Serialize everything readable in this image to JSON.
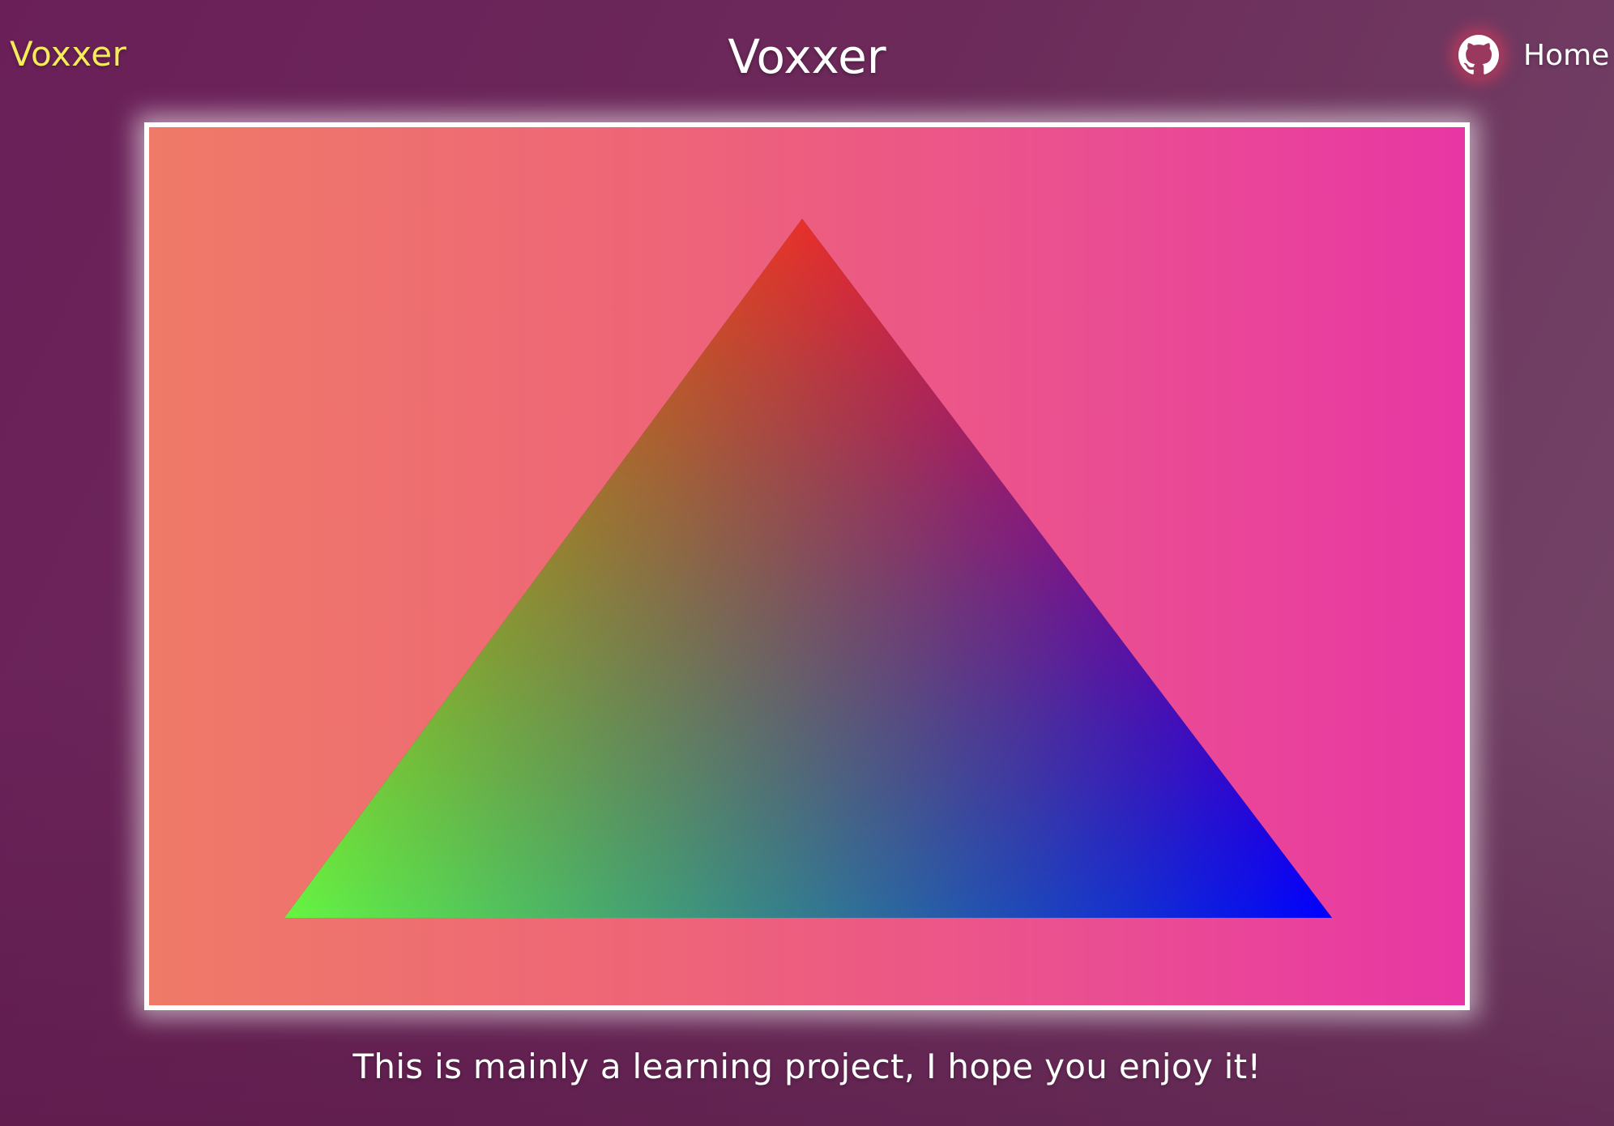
{
  "nav": {
    "brand": "Voxxer",
    "title": "Voxxer",
    "github_icon": "github-icon",
    "home_label": "Home"
  },
  "canvas": {
    "vertex_colors": {
      "top": "#e8302a",
      "bottom_left": "#66f542",
      "bottom_right": "#0000ff"
    },
    "background_gradient": [
      "#ef7a68",
      "#e836a4"
    ]
  },
  "footer": {
    "text": "This is mainly a learning project, I hope you enjoy it!"
  },
  "colors": {
    "brand": "#f5ec5a",
    "text": "#ffffff",
    "background": "#6a1f58"
  }
}
